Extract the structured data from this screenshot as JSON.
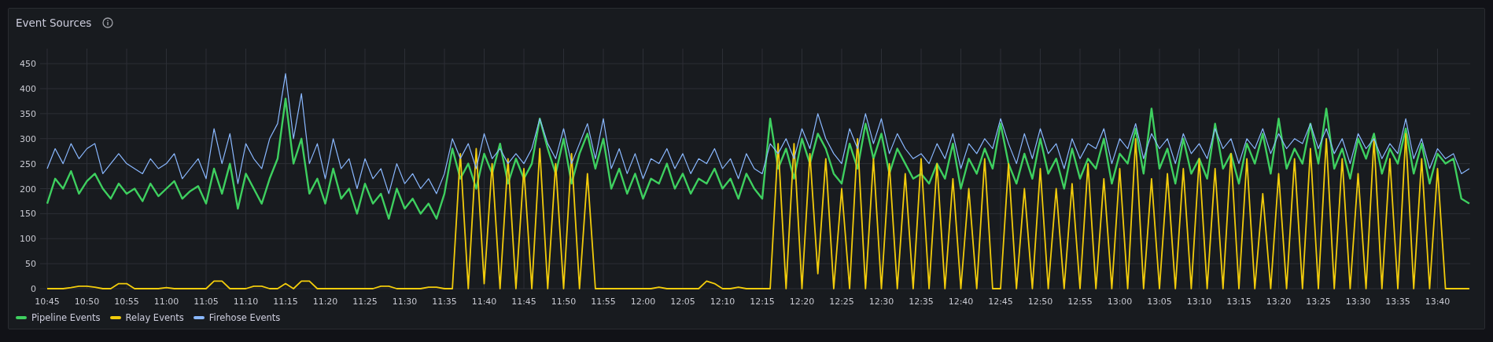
{
  "panel": {
    "title": "Event Sources",
    "chart_data": {
      "type": "line",
      "grid": true,
      "ylim": [
        0,
        480
      ],
      "yticks": [
        0,
        50,
        100,
        150,
        200,
        250,
        300,
        350,
        400,
        450
      ],
      "categories": [
        "10:45",
        null,
        null,
        null,
        null,
        "10:50",
        null,
        null,
        null,
        null,
        "10:55",
        null,
        null,
        null,
        null,
        "11:00",
        null,
        null,
        null,
        null,
        "11:05",
        null,
        null,
        null,
        null,
        "11:10",
        null,
        null,
        null,
        null,
        "11:15",
        null,
        null,
        null,
        null,
        "11:20",
        null,
        null,
        null,
        null,
        "11:25",
        null,
        null,
        null,
        null,
        "11:30",
        null,
        null,
        null,
        null,
        "11:35",
        null,
        null,
        null,
        null,
        "11:40",
        null,
        null,
        null,
        null,
        "11:45",
        null,
        null,
        null,
        null,
        "11:50",
        null,
        null,
        null,
        null,
        "11:55",
        null,
        null,
        null,
        null,
        "12:00",
        null,
        null,
        null,
        null,
        "12:05",
        null,
        null,
        null,
        null,
        "12:10",
        null,
        null,
        null,
        null,
        "12:15",
        null,
        null,
        null,
        null,
        "12:20",
        null,
        null,
        null,
        null,
        "12:25",
        null,
        null,
        null,
        null,
        "12:30",
        null,
        null,
        null,
        null,
        "12:35",
        null,
        null,
        null,
        null,
        "12:40",
        null,
        null,
        null,
        null,
        "12:45",
        null,
        null,
        null,
        null,
        "12:50",
        null,
        null,
        null,
        null,
        "12:55",
        null,
        null,
        null,
        null,
        "13:00",
        null,
        null,
        null,
        null,
        "13:05",
        null,
        null,
        null,
        null,
        "13:10",
        null,
        null,
        null,
        null,
        "13:15",
        null,
        null,
        null,
        null,
        "13:20",
        null,
        null,
        null,
        null,
        "13:25",
        null,
        null,
        null,
        null,
        "13:30",
        null,
        null,
        null,
        null,
        "13:35",
        null,
        null,
        null,
        null,
        "13:40",
        null,
        null,
        null,
        null
      ],
      "series": [
        {
          "name": "Pipeline Events",
          "color": "#3ecf5f",
          "values": [
            170,
            220,
            200,
            235,
            190,
            215,
            230,
            200,
            180,
            210,
            190,
            200,
            175,
            210,
            185,
            200,
            215,
            180,
            195,
            205,
            170,
            240,
            190,
            250,
            160,
            230,
            200,
            170,
            220,
            260,
            380,
            250,
            300,
            190,
            220,
            170,
            240,
            180,
            200,
            150,
            210,
            170,
            190,
            140,
            200,
            160,
            180,
            150,
            170,
            140,
            190,
            280,
            220,
            250,
            200,
            270,
            230,
            290,
            210,
            260,
            220,
            250,
            340,
            280,
            230,
            300,
            210,
            270,
            310,
            240,
            300,
            200,
            240,
            190,
            230,
            180,
            220,
            210,
            250,
            200,
            230,
            190,
            220,
            210,
            240,
            200,
            220,
            180,
            230,
            200,
            180,
            340,
            240,
            280,
            220,
            300,
            250,
            310,
            280,
            230,
            210,
            290,
            240,
            330,
            260,
            310,
            230,
            280,
            250,
            220,
            230,
            210,
            250,
            220,
            290,
            200,
            260,
            230,
            280,
            240,
            330,
            250,
            210,
            270,
            220,
            300,
            230,
            260,
            200,
            280,
            220,
            260,
            240,
            300,
            210,
            270,
            250,
            320,
            230,
            360,
            240,
            280,
            210,
            300,
            230,
            260,
            220,
            330,
            240,
            270,
            210,
            290,
            250,
            310,
            230,
            340,
            240,
            280,
            250,
            330,
            250,
            360,
            240,
            280,
            220,
            300,
            260,
            310,
            230,
            280,
            250,
            320,
            230,
            290,
            210,
            270,
            250,
            260,
            180,
            170
          ]
        },
        {
          "name": "Relay Events",
          "color": "#f2cc0c",
          "values": [
            0,
            0,
            0,
            2,
            5,
            5,
            3,
            0,
            0,
            10,
            10,
            0,
            0,
            0,
            0,
            2,
            0,
            0,
            0,
            0,
            0,
            15,
            15,
            0,
            0,
            0,
            5,
            5,
            0,
            0,
            10,
            0,
            15,
            15,
            0,
            0,
            0,
            0,
            0,
            0,
            0,
            0,
            5,
            5,
            0,
            0,
            0,
            0,
            3,
            3,
            0,
            0,
            270,
            0,
            280,
            10,
            250,
            0,
            260,
            0,
            240,
            0,
            280,
            0,
            250,
            0,
            270,
            0,
            230,
            0,
            0,
            0,
            0,
            0,
            0,
            0,
            0,
            3,
            0,
            0,
            0,
            0,
            0,
            15,
            10,
            0,
            0,
            3,
            0,
            0,
            0,
            0,
            290,
            0,
            290,
            0,
            270,
            30,
            260,
            0,
            200,
            0,
            300,
            0,
            260,
            0,
            250,
            0,
            230,
            0,
            260,
            0,
            250,
            0,
            220,
            0,
            200,
            0,
            260,
            0,
            0,
            250,
            0,
            200,
            0,
            240,
            0,
            200,
            0,
            210,
            0,
            250,
            0,
            220,
            0,
            240,
            0,
            300,
            0,
            220,
            0,
            230,
            0,
            240,
            0,
            260,
            0,
            240,
            0,
            270,
            0,
            260,
            0,
            190,
            0,
            230,
            0,
            260,
            0,
            280,
            0,
            300,
            0,
            260,
            0,
            230,
            0,
            300,
            0,
            260,
            0,
            310,
            0,
            260,
            0,
            240,
            0,
            0,
            0,
            0
          ]
        },
        {
          "name": "Firehose Events",
          "color": "#8ab8ff",
          "values": [
            240,
            280,
            250,
            290,
            260,
            280,
            290,
            230,
            250,
            270,
            250,
            240,
            230,
            260,
            240,
            250,
            270,
            220,
            240,
            260,
            220,
            320,
            250,
            310,
            210,
            290,
            260,
            240,
            300,
            330,
            430,
            300,
            390,
            250,
            290,
            220,
            300,
            240,
            260,
            200,
            260,
            220,
            240,
            190,
            250,
            210,
            230,
            200,
            220,
            190,
            230,
            300,
            260,
            290,
            240,
            310,
            260,
            280,
            250,
            270,
            250,
            280,
            340,
            290,
            260,
            320,
            250,
            290,
            330,
            260,
            340,
            240,
            280,
            230,
            270,
            220,
            260,
            250,
            280,
            240,
            270,
            230,
            260,
            250,
            280,
            240,
            260,
            220,
            270,
            240,
            230,
            290,
            270,
            300,
            260,
            320,
            280,
            350,
            300,
            270,
            250,
            320,
            280,
            350,
            290,
            340,
            270,
            310,
            280,
            260,
            270,
            250,
            290,
            260,
            310,
            240,
            290,
            270,
            300,
            280,
            340,
            290,
            250,
            310,
            260,
            320,
            270,
            290,
            240,
            300,
            260,
            290,
            280,
            320,
            250,
            300,
            280,
            330,
            260,
            310,
            280,
            300,
            250,
            310,
            270,
            290,
            260,
            320,
            280,
            300,
            250,
            300,
            280,
            320,
            270,
            310,
            280,
            300,
            290,
            330,
            280,
            320,
            270,
            300,
            250,
            310,
            280,
            300,
            260,
            290,
            270,
            340,
            260,
            300,
            240,
            280,
            260,
            270,
            230,
            240
          ]
        }
      ]
    }
  }
}
